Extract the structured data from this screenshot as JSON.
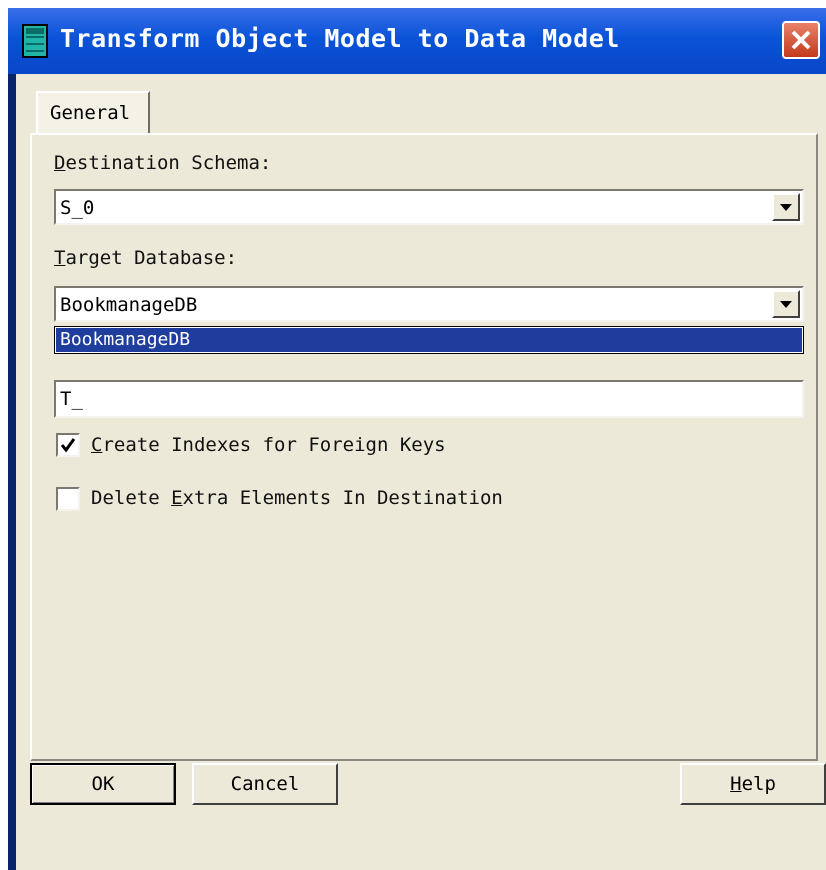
{
  "window": {
    "title": "Transform Object Model to Data Model",
    "title_icon": "database-icon",
    "close_icon": "close-icon"
  },
  "tabs": [
    {
      "label": "General",
      "selected": true
    }
  ],
  "form": {
    "destination_schema": {
      "label_prefix": "D",
      "label_rest": "estination Schema:",
      "value": "S_0"
    },
    "target_database": {
      "label_prefix": "T",
      "label_rest": "arget Database:",
      "value": "BookmanageDB",
      "options": [
        "BookmanageDB"
      ],
      "highlighted": "BookmanageDB"
    },
    "prefix": {
      "value": "T_"
    },
    "create_indexes": {
      "label_prefix": "C",
      "label_rest": "reate Indexes for Foreign Keys",
      "checked": true
    },
    "delete_extra": {
      "label_before": "Delete ",
      "label_prefix": "E",
      "label_rest": "xtra Elements In Destination",
      "checked": false
    }
  },
  "buttons": {
    "ok": "OK",
    "cancel": "Cancel",
    "help_prefix": "H",
    "help_rest": "elp"
  },
  "colors": {
    "titlebar": "#0a53d8",
    "dialog_bg": "#ece9d8",
    "selection": "#1e3d9c",
    "close_button": "#c23a1a"
  }
}
